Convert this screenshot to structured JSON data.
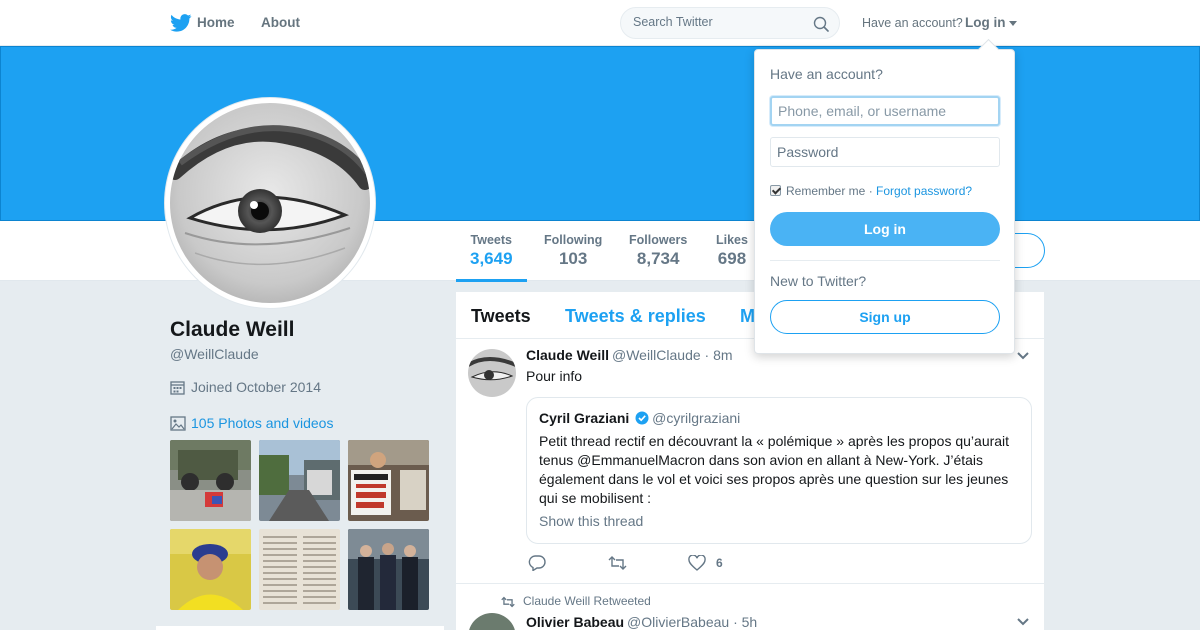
{
  "nav": {
    "home_label": "Home",
    "about_label": "About",
    "search_placeholder": "Search Twitter",
    "have_account": "Have an account?",
    "login_label": "Log in"
  },
  "colors": {
    "brand": "#1da1f2",
    "text": "#14171a",
    "muted": "#657786",
    "link": "#1b95e0",
    "background": "#e6ecf0"
  },
  "profile": {
    "name": "Claude Weill",
    "handle": "@WeillClaude",
    "joined": "Joined October 2014",
    "photos_link": "105 Photos and videos",
    "stats": [
      {
        "label": "Tweets",
        "value": "3,649"
      },
      {
        "label": "Following",
        "value": "103"
      },
      {
        "label": "Followers",
        "value": "8,734"
      },
      {
        "label": "Likes",
        "value": "698"
      }
    ]
  },
  "timeline": {
    "tabs": [
      "Tweets",
      "Tweets & replies",
      "M"
    ],
    "tweets": [
      {
        "author": "Claude Weill",
        "handle": "@WeillClaude",
        "time": "· 8m",
        "text": "Pour info",
        "quote": {
          "author": "Cyril Graziani",
          "handle": "@cyrilgraziani",
          "text": "Petit thread rectif en découvrant la « polémique » après les propos qu’aurait tenus @EmmanuelMacron dans son avion en allant à New-York. J’étais également dans le vol et voici ses propos après une question sur les jeunes qui se mobilisent :",
          "thread_link": "Show this thread"
        },
        "like_count": "6"
      },
      {
        "retweeted_by": "Claude Weill Retweeted",
        "author": "Olivier Babeau",
        "handle": "@OlivierBabeau",
        "time": "· 5h"
      }
    ]
  },
  "login_dropdown": {
    "title": "Have an account?",
    "username_placeholder": "Phone, email, or username",
    "password_placeholder": "Password",
    "remember_label": "Remember me",
    "separator": " · ",
    "forgot_label": "Forgot password?",
    "login_button": "Log in",
    "new_label": "New to Twitter?",
    "signup_button": "Sign up"
  }
}
